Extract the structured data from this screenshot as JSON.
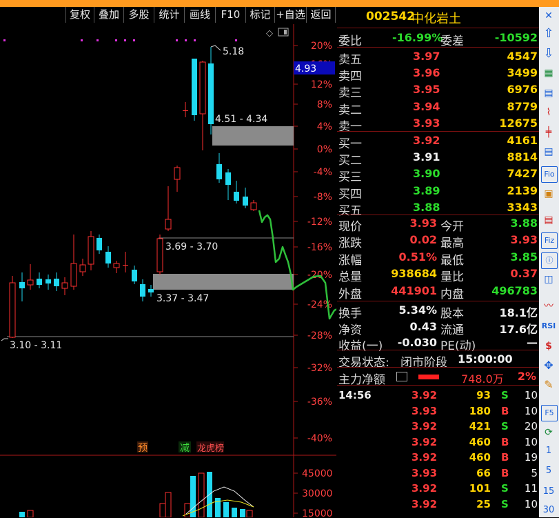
{
  "toolbar": {
    "items": [
      "复权",
      "叠加",
      "多股",
      "统计",
      "画线",
      "F10",
      "标记",
      "+自选",
      "返回"
    ]
  },
  "chart": {
    "y_axis_labels": [
      "20%",
      "16%",
      "12%",
      "8%",
      "4%",
      "0%",
      "-4%",
      "-8%",
      "-12%",
      "-16%",
      "-20%",
      "-24%",
      "-28%",
      "-32%",
      "-36%",
      "-40%"
    ],
    "price_tag": "4.93",
    "high_label": "5.18",
    "zone_labels": [
      "4.51 - 4.34",
      "3.69 - 3.70",
      "3.37 - 3.47",
      "3.10 - 3.11"
    ],
    "badges": [
      "预",
      "减",
      "龙虎榜"
    ],
    "volume_labels": [
      "45000",
      "30000",
      "15000"
    ]
  },
  "quote": {
    "code": "002542",
    "name": "中化岩土",
    "webi": {
      "label": "委比",
      "value": "-16.99%",
      "label2": "委差",
      "value2": "-10592"
    },
    "asks": [
      {
        "label": "卖五",
        "price": "3.97",
        "vol": "4547"
      },
      {
        "label": "卖四",
        "price": "3.96",
        "vol": "3499"
      },
      {
        "label": "卖三",
        "price": "3.95",
        "vol": "6976"
      },
      {
        "label": "卖二",
        "price": "3.94",
        "vol": "8779"
      },
      {
        "label": "卖一",
        "price": "3.93",
        "vol": "12675"
      }
    ],
    "bids": [
      {
        "label": "买一",
        "price": "3.92",
        "vol": "4161"
      },
      {
        "label": "买二",
        "price": "3.91",
        "vol": "8814"
      },
      {
        "label": "买三",
        "price": "3.90",
        "vol": "7427"
      },
      {
        "label": "买四",
        "price": "3.89",
        "vol": "2139"
      },
      {
        "label": "买五",
        "price": "3.88",
        "vol": "3343"
      }
    ],
    "stats": [
      {
        "l1": "现价",
        "v1": "3.93",
        "l2": "今开",
        "v2": "3.88"
      },
      {
        "l1": "涨跌",
        "v1": "0.02",
        "l2": "最高",
        "v2": "3.93"
      },
      {
        "l1": "涨幅",
        "v1": "0.51%",
        "l2": "最低",
        "v2": "3.85"
      },
      {
        "l1": "总量",
        "v1": "938684",
        "l2": "量比",
        "v2": "0.37"
      },
      {
        "l1": "外盘",
        "v1": "441901",
        "l2": "内盘",
        "v2": "496783"
      }
    ],
    "stats2": [
      {
        "l1": "换手",
        "v1": "5.34%",
        "l2": "股本",
        "v2": "18.1亿"
      },
      {
        "l1": "净资",
        "v1": "0.43",
        "l2": "流通",
        "v2": "17.6亿"
      },
      {
        "l1": "收益(一)",
        "v1": "-0.030",
        "l2": "PE(动)",
        "v2": "—"
      }
    ],
    "trade_status": {
      "label": "交易状态:",
      "value": "闭市阶段",
      "time": "15:00:00"
    },
    "main_flow": {
      "label": "主力净额",
      "value": "748.0万",
      "pct": "2%"
    },
    "ticks": [
      {
        "time": "14:56",
        "price": "3.92",
        "vol": "93",
        "side": "S",
        "n": "10"
      },
      {
        "time": "",
        "price": "3.93",
        "vol": "180",
        "side": "B",
        "n": "10"
      },
      {
        "time": "",
        "price": "3.92",
        "vol": "421",
        "side": "S",
        "n": "20"
      },
      {
        "time": "",
        "price": "3.92",
        "vol": "460",
        "side": "B",
        "n": "10"
      },
      {
        "time": "",
        "price": "3.92",
        "vol": "460",
        "side": "B",
        "n": "19"
      },
      {
        "time": "",
        "price": "3.93",
        "vol": "66",
        "side": "B",
        "n": "5"
      },
      {
        "time": "",
        "price": "3.92",
        "vol": "101",
        "side": "S",
        "n": "11"
      },
      {
        "time": "",
        "price": "3.92",
        "vol": "25",
        "side": "S",
        "n": "10"
      }
    ]
  },
  "iconbar": {
    "items": [
      "close-icon",
      "arrow-up-icon",
      "arrow-down-icon",
      "chart-icon",
      "grid-icon",
      "line-chart-icon",
      "kline-icon",
      "list-icon",
      "f10-icon",
      "f11-icon",
      "f-icon",
      "fiz-icon",
      "info-icon",
      "square-icon",
      "wave-icon",
      "rsi-icon",
      "dollar-icon",
      "move-icon",
      "pen-icon",
      "f5-icon",
      "refresh-icon",
      "num-1",
      "num-5",
      "num-15",
      "num-30"
    ],
    "labels": [
      "Fio",
      "RSI",
      "F5",
      "1",
      "5",
      "15",
      "30"
    ]
  }
}
